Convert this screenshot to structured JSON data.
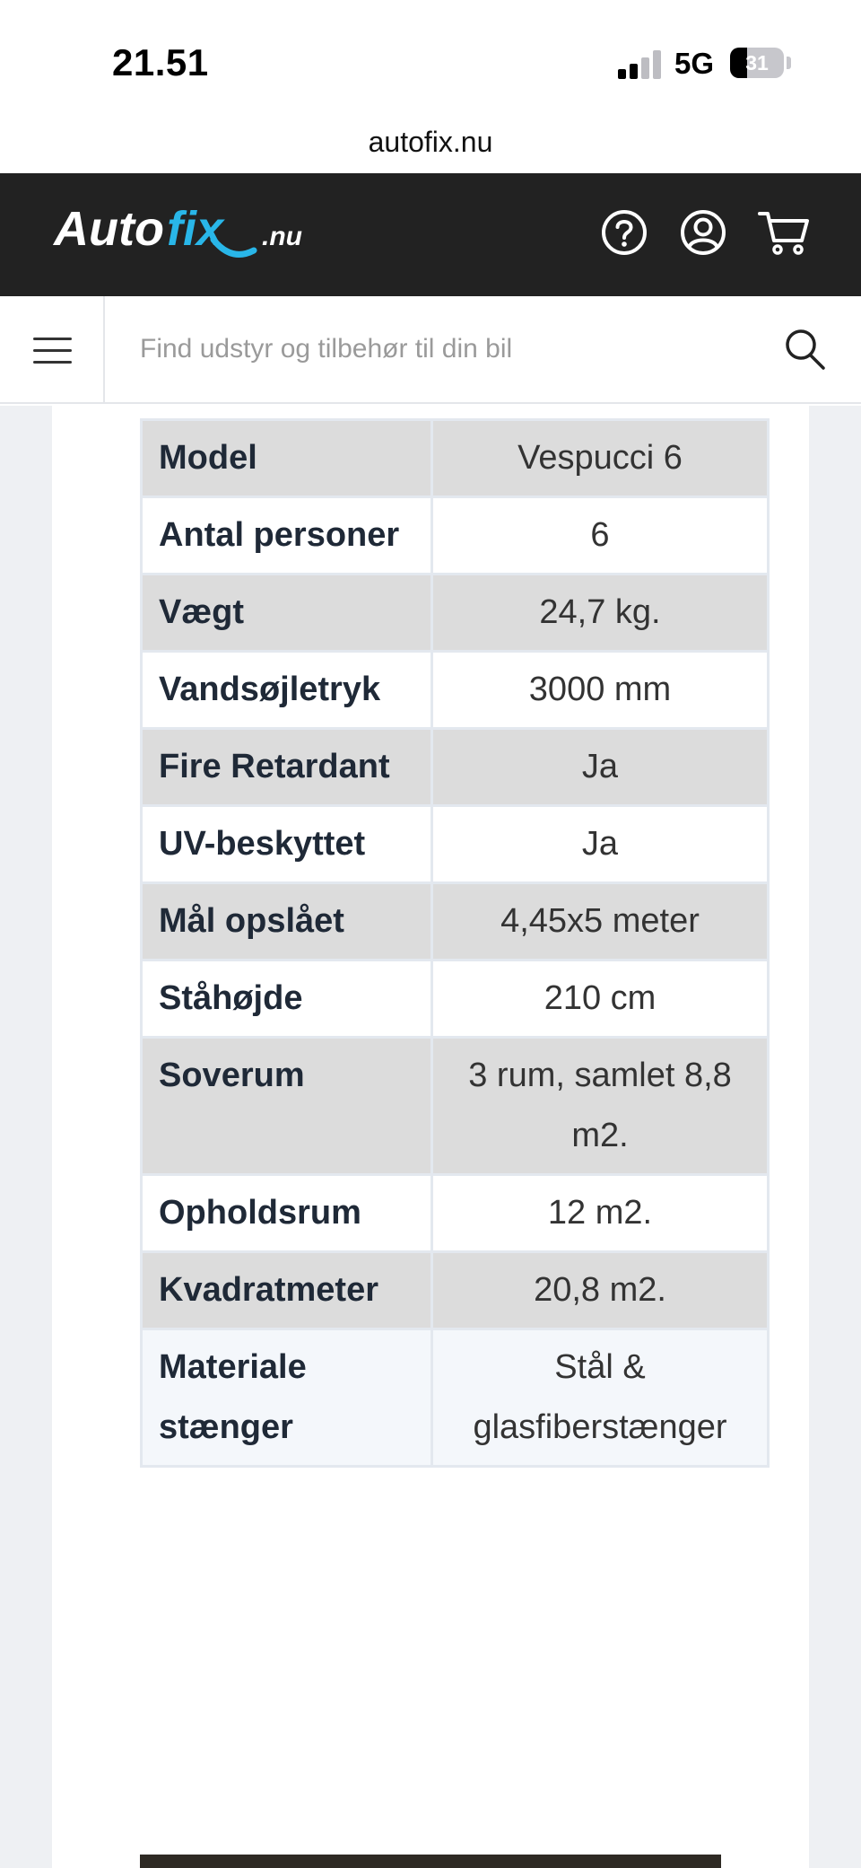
{
  "status_bar": {
    "time": "21.51",
    "network": "5G",
    "battery": "31"
  },
  "browser": {
    "url": "autofix.nu"
  },
  "header": {
    "logo_main": "Auto",
    "logo_accent": "fix",
    "logo_suffix": ".nu",
    "icons": [
      "help-icon",
      "account-icon",
      "cart-icon"
    ],
    "bg_color": "#222222",
    "accent_color": "#29b6e8"
  },
  "search": {
    "placeholder": "Find udstyr og tilbehør til din bil",
    "icons": [
      "menu-icon",
      "search-icon"
    ]
  },
  "specs": {
    "rows": [
      {
        "label": "Model",
        "value": "Vespucci 6"
      },
      {
        "label": "Antal personer",
        "value": "6"
      },
      {
        "label": "Vægt",
        "value": "24,7 kg."
      },
      {
        "label": "Vandsøjletryk",
        "value": "3000 mm"
      },
      {
        "label": "Fire Retardant",
        "value": "Ja"
      },
      {
        "label": "UV-beskyttet",
        "value": "Ja"
      },
      {
        "label": "Mål opslået",
        "value": "4,45x5 meter"
      },
      {
        "label": "Ståhøjde",
        "value": "210 cm"
      },
      {
        "label": "Soverum",
        "value": "3 rum, samlet 8,8 m2."
      },
      {
        "label": "Opholdsrum",
        "value": "12 m2."
      },
      {
        "label": "Kvadratmeter",
        "value": "20,8 m2."
      },
      {
        "label": "Materiale stænger",
        "value": "Stål & glasfiberstænger"
      }
    ]
  }
}
